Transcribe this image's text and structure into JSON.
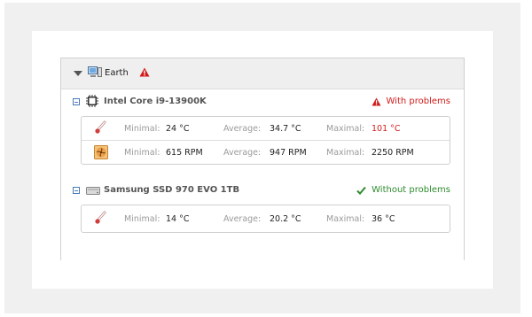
{
  "root": {
    "name": "Earth"
  },
  "labels": {
    "minimal": "Minimal:",
    "average": "Average:",
    "maximal": "Maximal:"
  },
  "colors": {
    "problem": "#d21a1a",
    "ok": "#2e8b2e"
  },
  "devices": [
    {
      "name": "Intel Core i9-13900K",
      "icon": "cpu-icon",
      "status": "With problems",
      "status_icon": "warning-icon",
      "sensors": [
        {
          "icon": "thermometer-icon",
          "minimal": "24 °C",
          "average": "34.7 °C",
          "maximal": "101 °C",
          "maximal_alert": true
        },
        {
          "icon": "fan-icon",
          "minimal": "615 RPM",
          "average": "947 RPM",
          "maximal": "2250 RPM",
          "maximal_alert": false
        }
      ]
    },
    {
      "name": "Samsung SSD 970 EVO 1TB",
      "icon": "drive-icon",
      "status": "Without problems",
      "status_icon": "checkmark-icon",
      "sensors": [
        {
          "icon": "thermometer-icon",
          "minimal": "14 °C",
          "average": "20.2 °C",
          "maximal": "36 °C",
          "maximal_alert": false
        }
      ]
    }
  ]
}
